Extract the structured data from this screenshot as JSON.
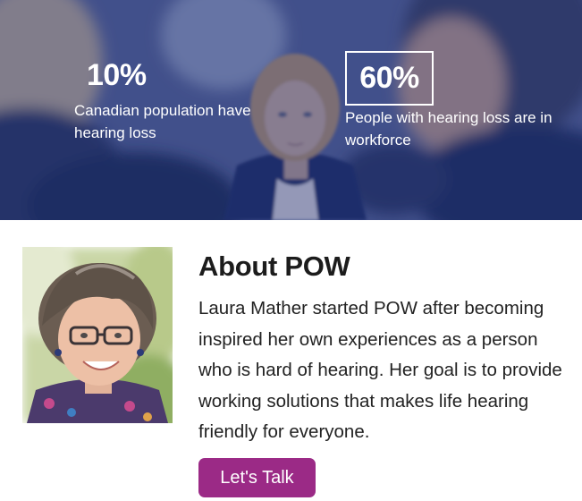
{
  "hero": {
    "stats": [
      {
        "value": "10%",
        "caption": "Canadian population have hearing loss"
      },
      {
        "value": "60%",
        "caption": "People with hearing loss are in workforce"
      }
    ]
  },
  "about": {
    "title": "About POW",
    "body": "Laura Mather started POW after becoming inspired her own experiences as a person who is hard of hearing. Her goal is to provide working solutions that makes life hearing friendly for everyone.",
    "button_label": "Let's Talk"
  },
  "colors": {
    "button": "#9b2a86",
    "hero_overlay": "#1e3278"
  }
}
